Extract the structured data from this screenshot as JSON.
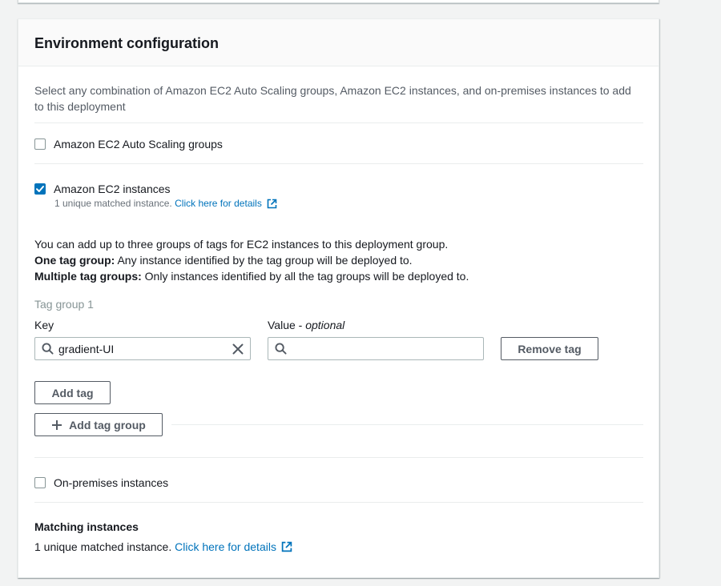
{
  "section": {
    "title": "Environment configuration",
    "description": "Select any combination of Amazon EC2 Auto Scaling groups, Amazon EC2 instances, and on-premises instances to add to this deployment"
  },
  "options": {
    "auto_scaling": {
      "label": "Amazon EC2 Auto Scaling groups",
      "checked": false
    },
    "ec2_instances": {
      "label": "Amazon EC2 instances",
      "checked": true,
      "note": "1 unique matched instance.",
      "details_link": "Click here for details"
    },
    "on_premises": {
      "label": "On-premises instances",
      "checked": false
    }
  },
  "tags_info": {
    "line1": "You can add up to three groups of tags for EC2 instances to this deployment group.",
    "one_group_bold": "One tag group:",
    "one_group_text": " Any instance identified by the tag group will be deployed to.",
    "multi_group_bold": "Multiple tag groups:",
    "multi_group_text": " Only instances identified by all the tag groups will be deployed to."
  },
  "tag_group": {
    "title": "Tag group 1",
    "key_label": "Key",
    "value_label": "Value - ",
    "value_optional": "optional",
    "key_value": "gradient-UI",
    "value_value": "",
    "remove_label": "Remove tag",
    "add_tag_label": "Add tag",
    "add_group_label": "Add tag group"
  },
  "matching": {
    "title": "Matching instances",
    "text": "1 unique matched instance.",
    "details_link": "Click here for details"
  },
  "colors": {
    "link": "#0073bb",
    "checkbox_checked": "#0073bb",
    "muted_text": "#545b64"
  }
}
